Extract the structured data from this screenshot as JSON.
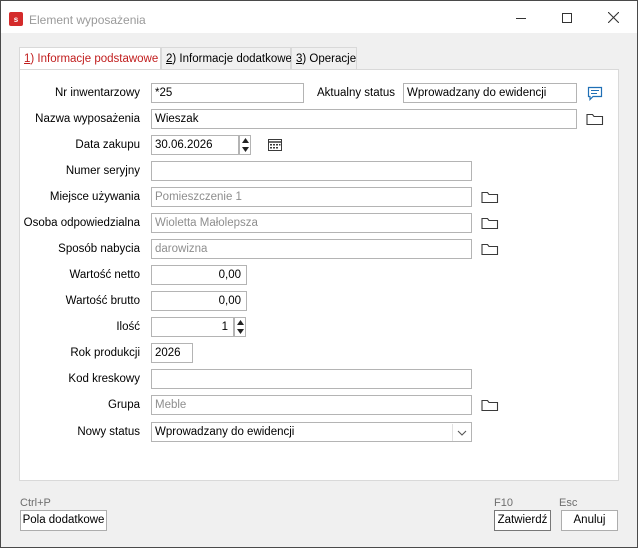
{
  "window": {
    "title": "Element wyposażenia",
    "icon_letter": "s"
  },
  "tabs": [
    {
      "num": "1",
      "label": ") Informacje podstawowe",
      "active": true
    },
    {
      "num": "2",
      "label": ") Informacje dodatkowe",
      "active": false
    },
    {
      "num": "3",
      "label": ") Operacje",
      "active": false
    }
  ],
  "form": {
    "nr_inwentarzowy": {
      "label": "Nr inwentarzowy",
      "value": "*25"
    },
    "aktualny_status": {
      "label": "Aktualny status",
      "value": "Wprowadzany do ewidencji"
    },
    "nazwa": {
      "label": "Nazwa wyposażenia",
      "value": "Wieszak"
    },
    "data_zakupu": {
      "label": "Data zakupu",
      "value": "30.06.2026"
    },
    "numer_seryjny": {
      "label": "Numer seryjny",
      "value": ""
    },
    "miejsce": {
      "label": "Miejsce używania",
      "value": "Pomieszczenie 1"
    },
    "osoba": {
      "label": "Osoba odpowiedzialna",
      "value": "Wioletta  Małolepsza"
    },
    "sposob": {
      "label": "Sposób nabycia",
      "value": "darowizna"
    },
    "netto": {
      "label": "Wartość netto",
      "value": "0,00"
    },
    "brutto": {
      "label": "Wartość brutto",
      "value": "0,00"
    },
    "ilosc": {
      "label": "Ilość",
      "value": "1"
    },
    "rok": {
      "label": "Rok produkcji",
      "value": "2026"
    },
    "kod": {
      "label": "Kod kreskowy",
      "value": ""
    },
    "grupa": {
      "label": "Grupa",
      "value": "Meble"
    },
    "nowy_status": {
      "label": "Nowy status",
      "value": "Wprowadzany do ewidencji"
    }
  },
  "footer": {
    "pola_shortcut": "Ctrl+P",
    "pola_label": "Pola dodatkowe",
    "zatwierdz_shortcut": "F10",
    "zatwierdz_label": "Zatwierdź",
    "anuluj_shortcut": "Esc",
    "anuluj_label": "Anuluj"
  },
  "colors": {
    "active_tab_text": "#c11d1d",
    "app_icon": "#d42b2b",
    "folder_icon": "#3a3a3a",
    "comment_icon": "#1f6fb5"
  },
  "icons": [
    "close-icon",
    "maximize-icon",
    "minimize-icon",
    "comment-icon",
    "folder-icon",
    "calendar-icon",
    "chevron-down-icon",
    "spin-up-icon",
    "spin-down-icon"
  ]
}
